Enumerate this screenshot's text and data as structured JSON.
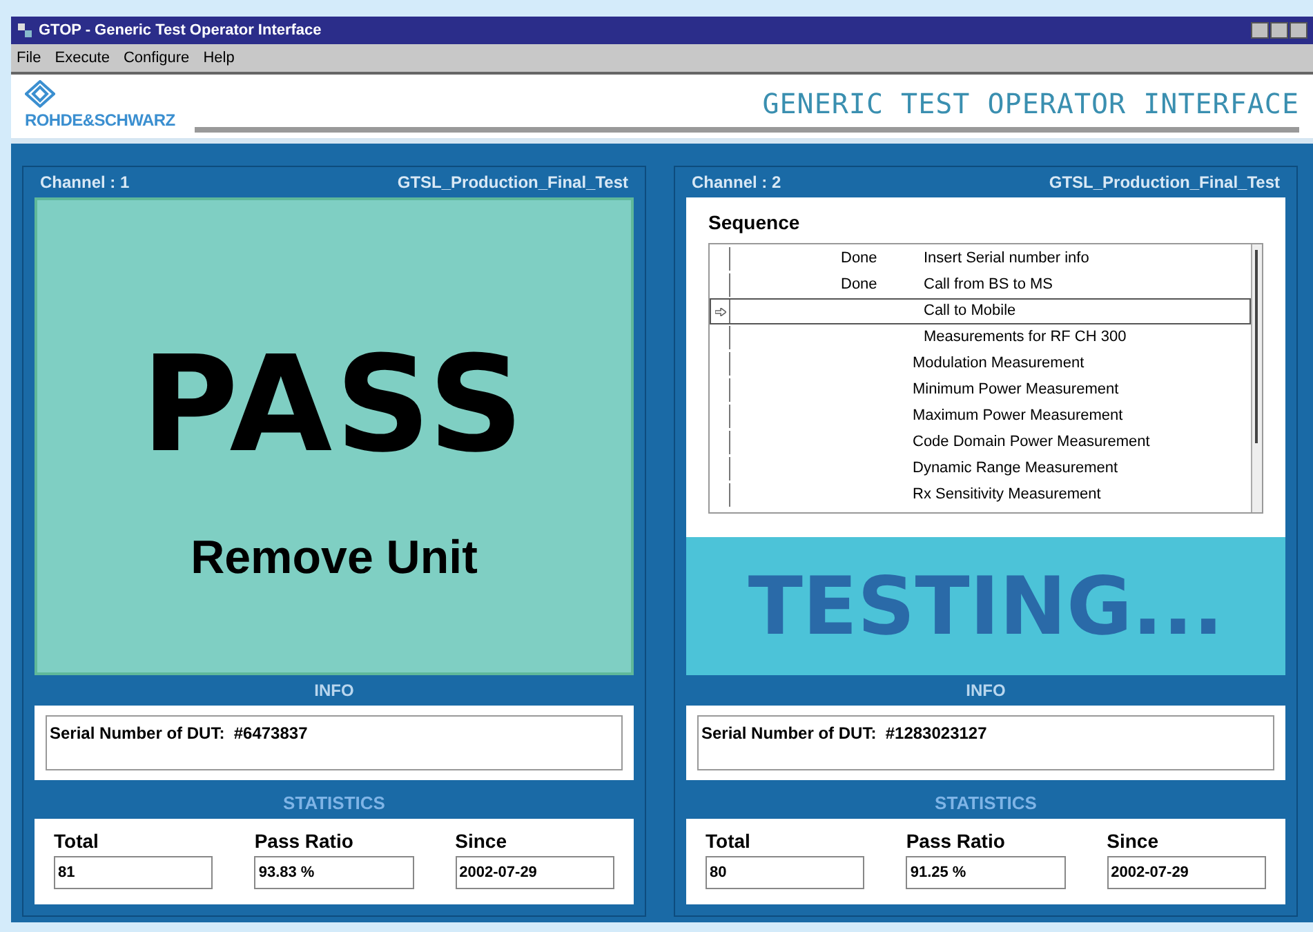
{
  "window": {
    "title": "GTOP - Generic Test Operator Interface"
  },
  "menu": [
    "File",
    "Execute",
    "Configure",
    "Help"
  ],
  "header": {
    "logo_text": "ROHDE&SCHWARZ",
    "title": "GENERIC TEST OPERATOR INTERFACE"
  },
  "channels": [
    {
      "label": "Channel : 1",
      "test_name": "GTSL_Production_Final_Test",
      "kind": "result",
      "result": {
        "kind": "pass",
        "headline": "PASS",
        "message": "Remove Unit"
      },
      "info_title": "INFO",
      "info_text": "Serial Number of DUT:  #6473837",
      "stats_title": "STATISTICS",
      "stats": [
        {
          "label": "Total",
          "value": "81"
        },
        {
          "label": "Pass Ratio",
          "value": "93.83 %"
        },
        {
          "label": "Since",
          "value": "2002-07-29"
        }
      ]
    },
    {
      "label": "Channel : 2",
      "test_name": "GTSL_Production_Final_Test",
      "kind": "sequence",
      "sequence_title": "Sequence",
      "steps": [
        {
          "kind": "step",
          "status": "Done",
          "name": "Insert Serial number info",
          "selected": false
        },
        {
          "kind": "step",
          "status": "Done",
          "name": "Call from BS to MS",
          "selected": false
        },
        {
          "kind": "step",
          "name": "Call to Mobile",
          "selected": true
        },
        {
          "kind": "step",
          "name": "Measurements for RF CH 300",
          "selected": false
        },
        {
          "kind": "sub",
          "name": "Modulation Measurement",
          "selected": false
        },
        {
          "kind": "sub",
          "name": "Minimum Power Measurement",
          "selected": false
        },
        {
          "kind": "sub",
          "name": "Maximum Power Measurement",
          "selected": false
        },
        {
          "kind": "sub",
          "name": "Code Domain Power Measurement",
          "selected": false
        },
        {
          "kind": "sub",
          "name": "Dynamic Range Measurement",
          "selected": false
        },
        {
          "kind": "sub",
          "name": "Rx Sensitivity Measurement",
          "selected": false
        }
      ],
      "status_text": "TESTING...",
      "info_title": "INFO",
      "info_text": "Serial Number of DUT:  #1283023127",
      "stats_title": "STATISTICS",
      "stats": [
        {
          "label": "Total",
          "value": "80"
        },
        {
          "label": "Pass Ratio",
          "value": "91.25 %"
        },
        {
          "label": "Since",
          "value": "2002-07-29"
        }
      ]
    }
  ]
}
